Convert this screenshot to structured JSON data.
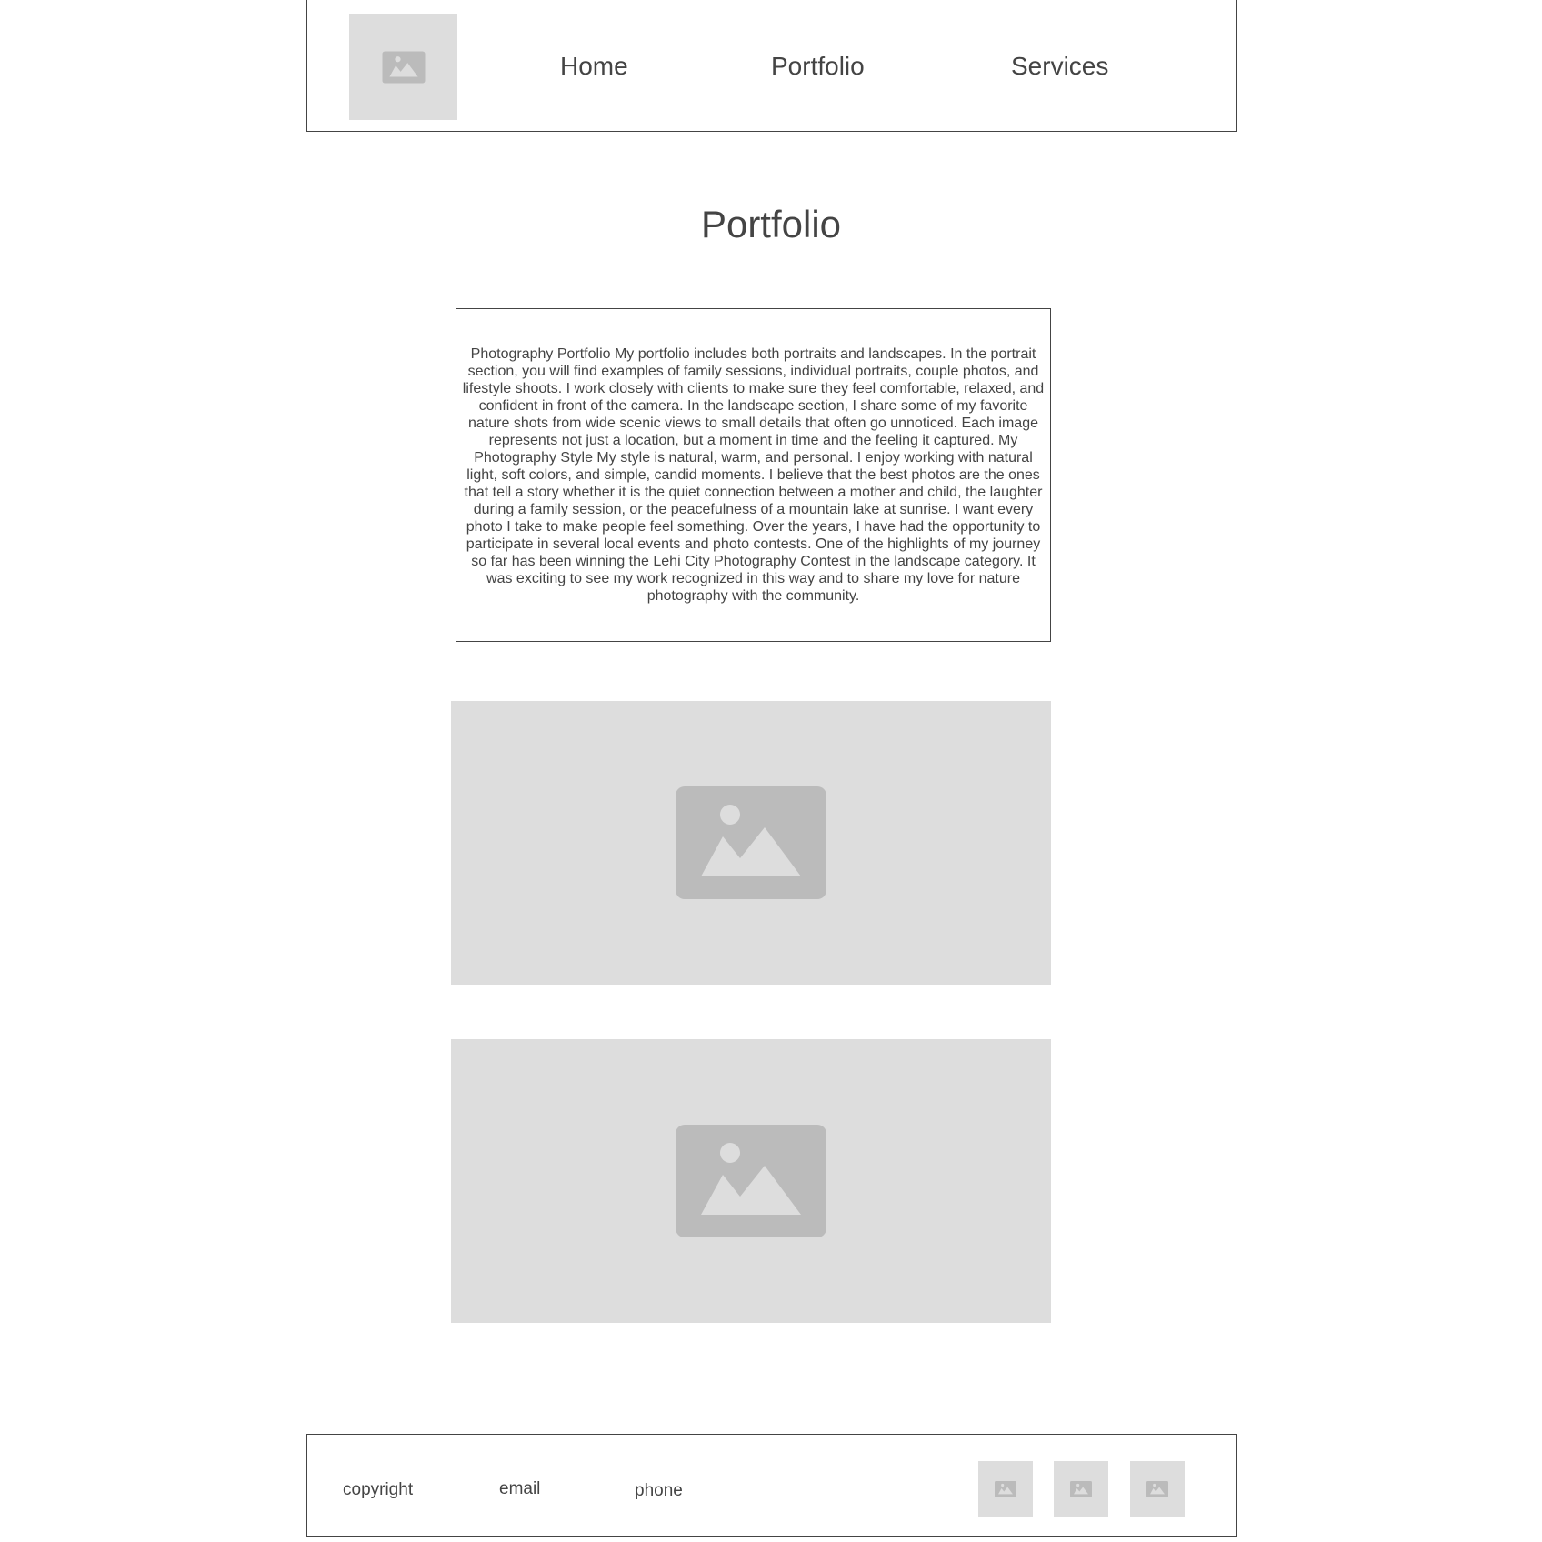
{
  "header": {
    "logo_icon": "image-placeholder-icon",
    "nav": [
      {
        "label": "Home"
      },
      {
        "label": "Portfolio"
      },
      {
        "label": "Services"
      }
    ]
  },
  "main": {
    "title": "Portfolio",
    "description": "Photography Portfolio My portfolio includes both portraits and landscapes. In the portrait section, you will find examples of family sessions, individual portraits, couple photos, and lifestyle shoots. I work closely with clients to make sure they feel comfortable, relaxed, and confident in front of the camera. In the landscape section, I share some of my favorite nature shots from wide scenic views to small details that often go unnoticed. Each image represents not just a location, but a moment in time and the feeling it captured. My Photography Style My style is natural, warm, and personal. I enjoy working with natural light, soft colors, and simple, candid moments. I believe that the best photos are the ones that tell a story whether it is the quiet connection between a mother and child, the laughter during a family session, or the peacefulness of a mountain lake at sunrise. I want every photo I take to make people feel something. Over the years, I have had the opportunity to participate in several local events and photo contests. One of the highlights of my journey so far has been winning the Lehi City Photography Contest in the landscape category. It was exciting to see my work recognized in this way and to share my love for nature photography with the community.",
    "images": [
      {
        "icon": "image-placeholder-icon"
      },
      {
        "icon": "image-placeholder-icon"
      }
    ]
  },
  "footer": {
    "copyright": "copyright",
    "email": "email",
    "phone": "phone",
    "social_icons": [
      "image-placeholder-icon",
      "image-placeholder-icon",
      "image-placeholder-icon"
    ]
  },
  "colors": {
    "text": "#444444",
    "placeholder_bg": "#dddddd",
    "placeholder_icon": "#bbbbbb",
    "border": "#444444"
  }
}
